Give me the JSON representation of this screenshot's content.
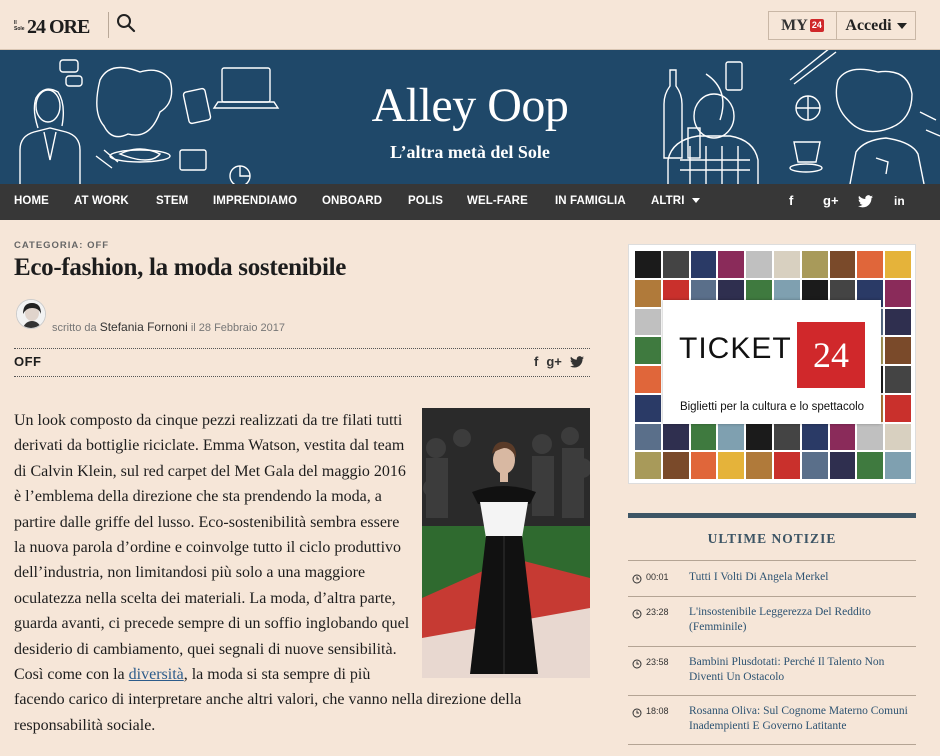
{
  "header": {
    "logo_small": "Il Sole",
    "logo_big": "24 ORE",
    "my_label": "MY",
    "my_badge": "24",
    "login_label": "Accedi"
  },
  "banner": {
    "title": "Alley Oop",
    "subtitle": "L’altra metà del Sole"
  },
  "nav": {
    "items": [
      "HOME",
      "AT WORK",
      "STEM",
      "IMPRENDIAMO",
      "ONBOARD",
      "POLIS",
      "WEL-FARE",
      "IN FAMIGLIA",
      "ALTRI"
    ],
    "social": [
      "f",
      "g+",
      "twitter",
      "in"
    ]
  },
  "article": {
    "category": "CATEGORIA: OFF",
    "title": "Eco-fashion, la moda sostenibile",
    "byline_prefix": "scritto da",
    "author": "Stefania Fornoni",
    "date_prefix": "il",
    "date": "28 Febbraio 2017",
    "tag": "OFF",
    "body_before_link": "Un look composto da cinque pezzi realizzati da tre filati tutti derivati da bottiglie riciclate. Emma Watson, vestita dal team di Calvin Klein, sul red carpet del Met Gala del maggio 2016 è l’emblema della direzione che sta prendendo la moda, a partire dalle griffe del lusso. Eco-sostenibilità sembra essere la nuova parola d’ordine e coinvolge tutto il ciclo produttivo dell’industria, non limitandosi più solo a una maggiore oculatezza nella scelta dei materiali. La moda, d’altra parte, guarda avanti, ci precede sempre di un soffio inglobando quel desiderio di cambiamento, quei segnali di nuove sensibilità. Così come con la ",
    "body_link": "diversità",
    "body_after_link": ", la moda si sta sempre di più facendo carico di interpretare anche altri valori, che vanno nella direzione della responsabilità sociale."
  },
  "ticket": {
    "word": "TICKET",
    "number": "24",
    "tagline": "Biglietti per la cultura e lo spettacolo"
  },
  "news": {
    "heading": "ULTIME NOTIZIE",
    "items": [
      {
        "time": "00:01",
        "title": "Tutti I Volti Di Angela Merkel"
      },
      {
        "time": "23:28",
        "title": "L'insostenibile Leggerezza Del Reddito (Femminile)"
      },
      {
        "time": "23:58",
        "title": "Bambini Plusdotati: Perché Il Talento Non Diventi Un Ostacolo"
      },
      {
        "time": "18:08",
        "title": "Rosanna Oliva: Sul Cognome Materno Comuni Inadempienti E Governo Latitante"
      }
    ]
  },
  "colors": {
    "background": "#f6e6d8",
    "banner": "#1f4869",
    "nav": "#373737",
    "brand_red": "#d0282b",
    "news_accent": "#3d5565"
  }
}
